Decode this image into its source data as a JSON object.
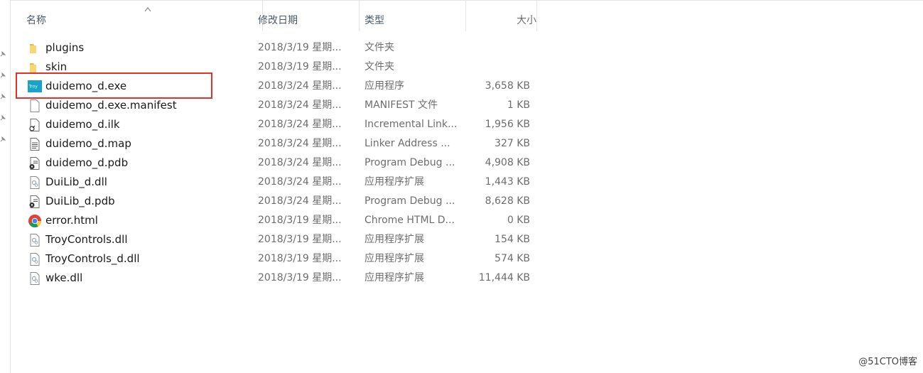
{
  "columns": {
    "name": "名称",
    "date": "修改日期",
    "type": "类型",
    "size": "大小"
  },
  "files": [
    {
      "name": "plugins",
      "date": "2018/3/19 星期...",
      "type": "文件夹",
      "size": "",
      "icon": "folder-icon"
    },
    {
      "name": "skin",
      "date": "2018/3/19 星期...",
      "type": "文件夹",
      "size": "",
      "icon": "folder-icon"
    },
    {
      "name": "duidemo_d.exe",
      "date": "2018/3/24 星期...",
      "type": "应用程序",
      "size": "3,658 KB",
      "icon": "troy-app-icon"
    },
    {
      "name": "duidemo_d.exe.manifest",
      "date": "2018/3/24 星期...",
      "type": "MANIFEST 文件",
      "size": "1 KB",
      "icon": "blank-file-icon"
    },
    {
      "name": "duidemo_d.ilk",
      "date": "2018/3/24 星期...",
      "type": "Incremental Link...",
      "size": "1,956 KB",
      "icon": "ilk-file-icon"
    },
    {
      "name": "duidemo_d.map",
      "date": "2018/3/24 星期...",
      "type": "Linker Address ...",
      "size": "327 KB",
      "icon": "text-file-icon"
    },
    {
      "name": "duidemo_d.pdb",
      "date": "2018/3/24 星期...",
      "type": "Program Debug ...",
      "size": "4,908 KB",
      "icon": "pdb-file-icon"
    },
    {
      "name": "DuiLib_d.dll",
      "date": "2018/3/24 星期...",
      "type": "应用程序扩展",
      "size": "1,443 KB",
      "icon": "dll-file-icon"
    },
    {
      "name": "DuiLib_d.pdb",
      "date": "2018/3/24 星期...",
      "type": "Program Debug ...",
      "size": "8,628 KB",
      "icon": "pdb-file-icon"
    },
    {
      "name": "error.html",
      "date": "2018/3/19 星期...",
      "type": "Chrome HTML D...",
      "size": "0 KB",
      "icon": "chrome-icon"
    },
    {
      "name": "TroyControls.dll",
      "date": "2018/3/19 星期...",
      "type": "应用程序扩展",
      "size": "154 KB",
      "icon": "dll-file-icon"
    },
    {
      "name": "TroyControls_d.dll",
      "date": "2018/3/19 星期...",
      "type": "应用程序扩展",
      "size": "574 KB",
      "icon": "dll-file-icon"
    },
    {
      "name": "wke.dll",
      "date": "2018/3/19 星期...",
      "type": "应用程序扩展",
      "size": "11,444 KB",
      "icon": "dll-file-icon"
    }
  ],
  "troy_icon_text": "Troy",
  "watermark": "@51CTO博客",
  "colors": {
    "highlight": "#e0312a",
    "folder": "#f8d775",
    "header_text": "#4d5a6b"
  }
}
